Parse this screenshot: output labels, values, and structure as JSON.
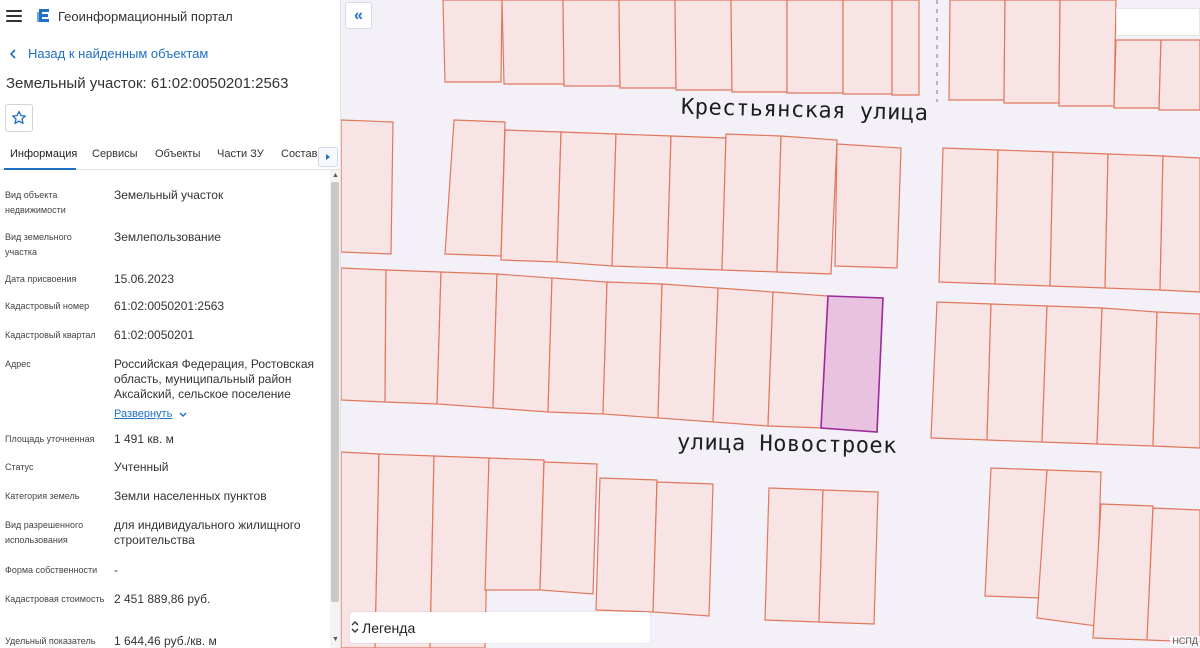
{
  "app": {
    "title": "Геоинформационный портал"
  },
  "nav": {
    "back_label": "Назад к найденным объектам"
  },
  "page": {
    "title": "Земельный участок: 61:02:0050201:2563"
  },
  "tabs": [
    {
      "label": "Информация",
      "active": true
    },
    {
      "label": "Сервисы",
      "active": false
    },
    {
      "label": "Объекты",
      "active": false
    },
    {
      "label": "Части ЗУ",
      "active": false
    },
    {
      "label": "Состав",
      "active": false
    }
  ],
  "properties": [
    {
      "label": "Вид объекта недвижимости",
      "value": "Земельный участок"
    },
    {
      "label": "Вид земельного участка",
      "value": "Землепользование"
    },
    {
      "label": "Дата присвоения",
      "value": "15.06.2023"
    },
    {
      "label": "Кадастровый номер",
      "value": "61:02:0050201:2563"
    },
    {
      "label": "Кадастровый квартал",
      "value": "61:02:0050201"
    },
    {
      "label": "Адрес",
      "value": "Российская Федерация, Ростовская область, муниципальный район Аксайский, сельское поселение",
      "expand_label": "Развернуть"
    },
    {
      "label": "Площадь уточненная",
      "value": "1 491 кв. м"
    },
    {
      "label": "Статус",
      "value": "Учтенный"
    },
    {
      "label": "Категория земель",
      "value": "Земли населенных пунктов"
    },
    {
      "label": "Вид разрешенного использования",
      "value": "для индивидуального жилищного строительства"
    },
    {
      "label": "Форма собственности",
      "value": "-"
    },
    {
      "label": "Кадастровая стоимость",
      "value": "2 451 889,86 руб."
    },
    {
      "label": "Удельный показатель",
      "value": "1 644,46 руб./кв. м"
    }
  ],
  "map": {
    "streets": [
      "Крестьянская улица",
      "улица Новостроек"
    ],
    "legend_label": "Легенда",
    "attribution": "НСПД",
    "colors": {
      "parcel_fill": "#f8e3e5",
      "parcel_stroke": "#e0785e",
      "selected_fill": "#e8c2de",
      "selected_stroke": "#9b2a9a",
      "road": "#f3f1f7",
      "accent": "#1f6fc5"
    }
  },
  "icons": {
    "menu": "menu-icon",
    "logo": "portal-logo-icon",
    "back": "chevron-left-icon",
    "favorite": "star-icon",
    "tabs_next": "chevron-right-icon",
    "expand": "chevron-down-icon",
    "collapse_panel": "double-chevron-left-icon",
    "legend_select": "select-arrows-icon"
  }
}
